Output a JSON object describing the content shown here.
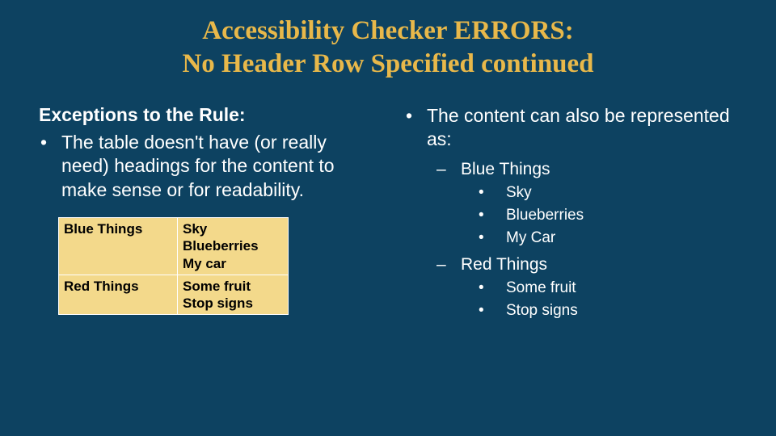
{
  "title_line1": "Accessibility Checker ERRORS:",
  "title_line2": "No Header Row Specified continued",
  "left": {
    "heading": "Exceptions to the Rule:",
    "bullet": "The table doesn't have (or really need) headings for the content to make sense or for readability.",
    "table": {
      "rows": [
        {
          "label": "Blue Things",
          "values": [
            "Sky",
            "Blueberries",
            "My car"
          ]
        },
        {
          "label": "Red Things",
          "values": [
            "Some fruit",
            "Stop signs"
          ]
        }
      ]
    }
  },
  "right": {
    "bullet": "The content can also be represented as:",
    "groups": [
      {
        "name": "Blue Things",
        "items": [
          "Sky",
          "Blueberries",
          "My Car"
        ]
      },
      {
        "name": "Red Things",
        "items": [
          "Some fruit",
          "Stop signs"
        ]
      }
    ]
  }
}
